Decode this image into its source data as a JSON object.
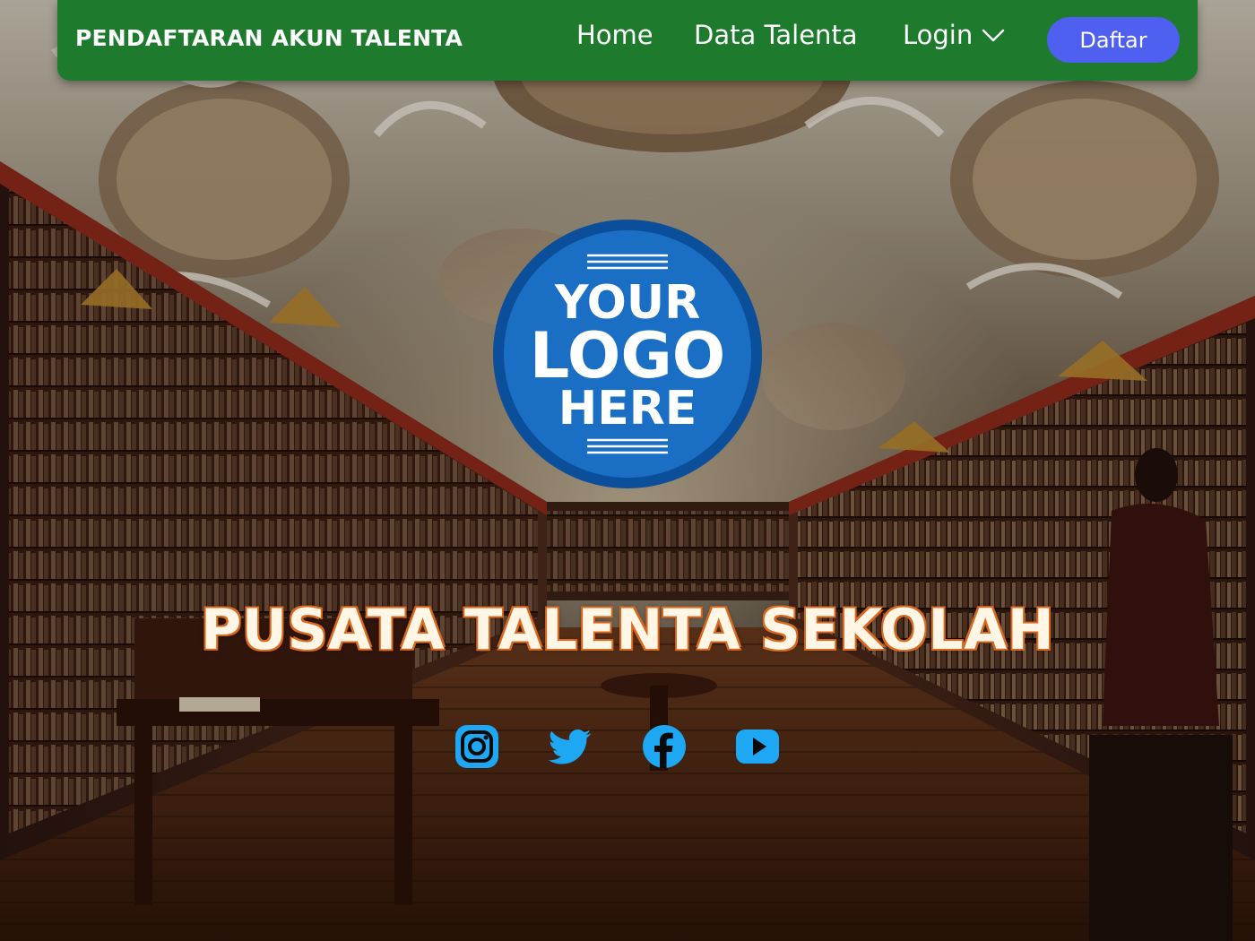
{
  "navbar": {
    "brand": "PENDAFTARAN AKUN TALENTA",
    "links": [
      {
        "label": "Home"
      },
      {
        "label": "Data Talenta"
      },
      {
        "label": "Login",
        "icon": "chevron-down-icon"
      }
    ],
    "cta_label": "Daftar"
  },
  "logo": {
    "lines": [
      "YOUR",
      "LOGO",
      "HERE"
    ]
  },
  "hero": {
    "title": "PUSATA TALENTA SEKOLAH"
  },
  "socials": [
    {
      "icon": "instagram-icon"
    },
    {
      "icon": "twitter-icon"
    },
    {
      "icon": "facebook-icon"
    },
    {
      "icon": "youtube-icon"
    }
  ],
  "colors": {
    "navbar_bg": "#1e7a2c",
    "cta_bg": "#4f5ff0",
    "logo_blue": "#1a6fc4",
    "social_blue": "#1ea7f2",
    "title_outline": "#d9691f"
  }
}
